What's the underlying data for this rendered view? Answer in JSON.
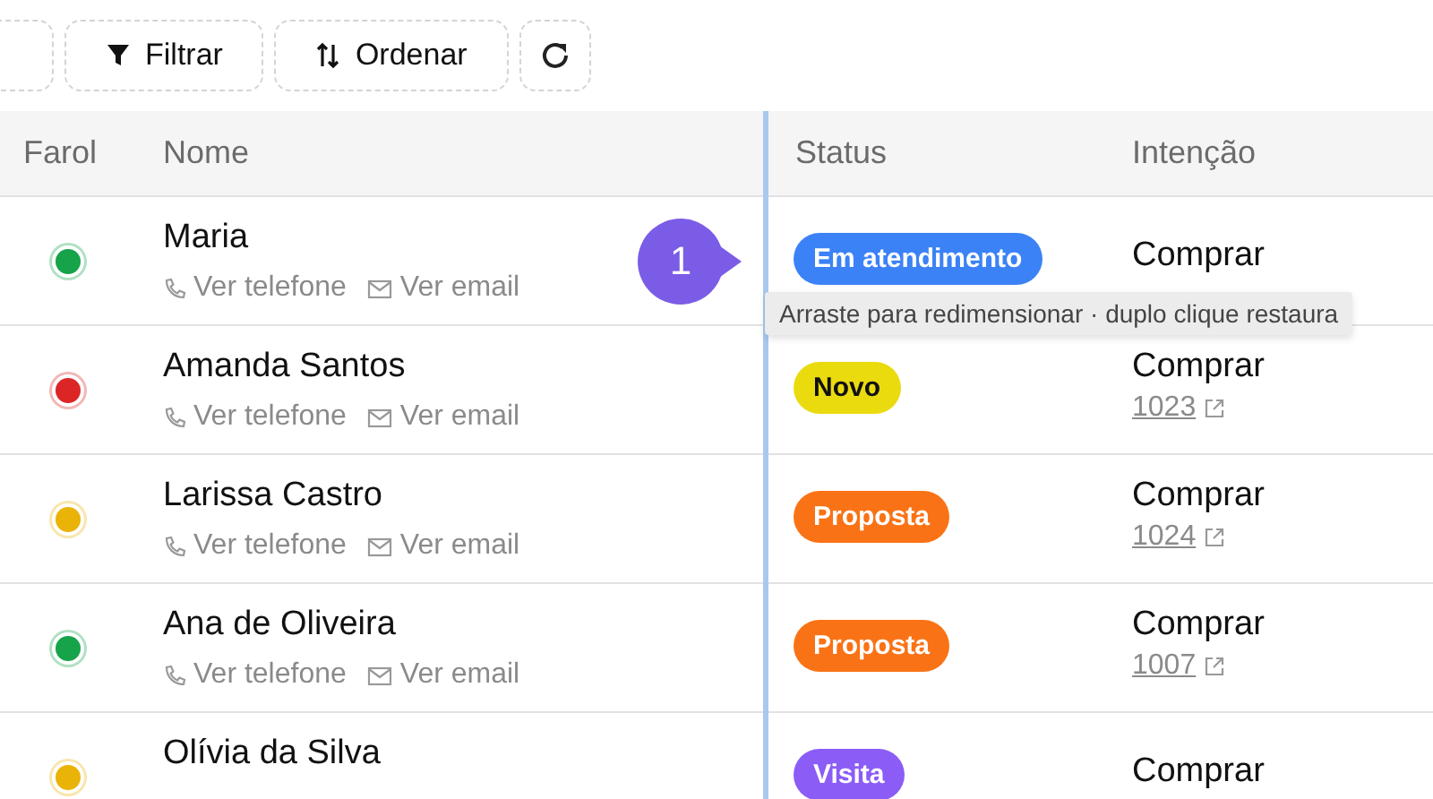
{
  "toolbar": {
    "buttons": [
      {
        "kind": "blank"
      },
      {
        "kind": "filter",
        "label": "Filtrar"
      },
      {
        "kind": "sort",
        "label": "Ordenar"
      },
      {
        "kind": "refresh"
      }
    ]
  },
  "table": {
    "columns": [
      "Farol",
      "Nome",
      "Status",
      "Intenção"
    ],
    "rows": [
      {
        "lamp": {
          "color": "#16a34a"
        },
        "name": "Maria",
        "phone": "Ver telefone",
        "email": "Ver email",
        "status": {
          "label": "Em atendimento",
          "color": "#3b82f6"
        },
        "intent": "Comprar"
      },
      {
        "lamp": {
          "color": "#dc2626"
        },
        "name": "Amanda Santos",
        "phone": "Ver telefone",
        "email": "Ver email",
        "status": {
          "label": "Novo",
          "color": "#eadb0f"
        },
        "intent": "Comprar",
        "order": "1023"
      },
      {
        "lamp": {
          "color": "#eab308"
        },
        "name": "Larissa Castro",
        "phone": "Ver telefone",
        "email": "Ver email",
        "status": {
          "label": "Proposta",
          "color": "#f97316"
        },
        "intent": "Comprar",
        "order": "1024"
      },
      {
        "lamp": {
          "color": "#16a34a"
        },
        "name": "Ana de Oliveira",
        "phone": "Ver telefone",
        "email": "Ver email",
        "status": {
          "label": "Proposta",
          "color": "#f97316"
        },
        "intent": "Comprar",
        "order": "1007"
      },
      {
        "lamp": {
          "color": "#eab308"
        },
        "name": "Olívia da Silva",
        "status": {
          "label": "Visita",
          "color": "#8b5cf6"
        },
        "intent": "Comprar"
      }
    ]
  },
  "step_marker": "1",
  "tooltip": "Arraste para redimensionar · duplo clique restaura"
}
